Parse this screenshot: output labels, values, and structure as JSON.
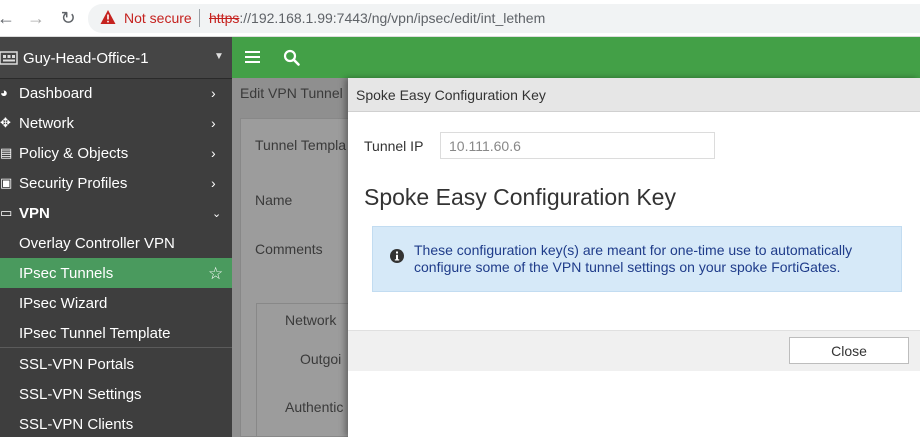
{
  "browser": {
    "not_secure": "Not secure",
    "url_scheme": "https",
    "url_rest": "://192.168.1.99:7443/ng/vpn/ipsec/edit/int_lethem"
  },
  "sidebar": {
    "device_name": "Guy-Head-Office-1",
    "items": [
      {
        "label": "Dashboard"
      },
      {
        "label": "Network"
      },
      {
        "label": "Policy & Objects"
      },
      {
        "label": "Security Profiles"
      },
      {
        "label": "VPN"
      },
      {
        "label": "Overlay Controller VPN"
      },
      {
        "label": "IPsec Tunnels"
      },
      {
        "label": "IPsec Wizard"
      },
      {
        "label": "IPsec Tunnel Template"
      },
      {
        "label": "SSL-VPN Portals"
      },
      {
        "label": "SSL-VPN Settings"
      },
      {
        "label": "SSL-VPN Clients"
      }
    ]
  },
  "background_page": {
    "breadcrumb": "Edit VPN Tunnel",
    "labels": {
      "tunnel_template": "Tunnel Templa",
      "name": "Name",
      "comments": "Comments",
      "network": "Network",
      "outgoing": "Outgoi",
      "authentication": "Authentic"
    }
  },
  "dialog": {
    "title": "Spoke Easy Configuration Key",
    "tunnel_ip_label": "Tunnel IP",
    "tunnel_ip_value": "10.111.60.6",
    "heading": "Spoke Easy Configuration Key",
    "info_text": "These configuration key(s) are meant for one-time use to automatically configure some of the VPN tunnel settings on your spoke FortiGates.",
    "close_label": "Close"
  },
  "colors": {
    "sidebar_bg": "#3e3e3e",
    "topbar_green": "#43a047",
    "active_item": "#4a9a5e",
    "info_bg": "#d6e9f8",
    "info_text": "#1f3c8a",
    "not_secure_red": "#c5221f"
  }
}
